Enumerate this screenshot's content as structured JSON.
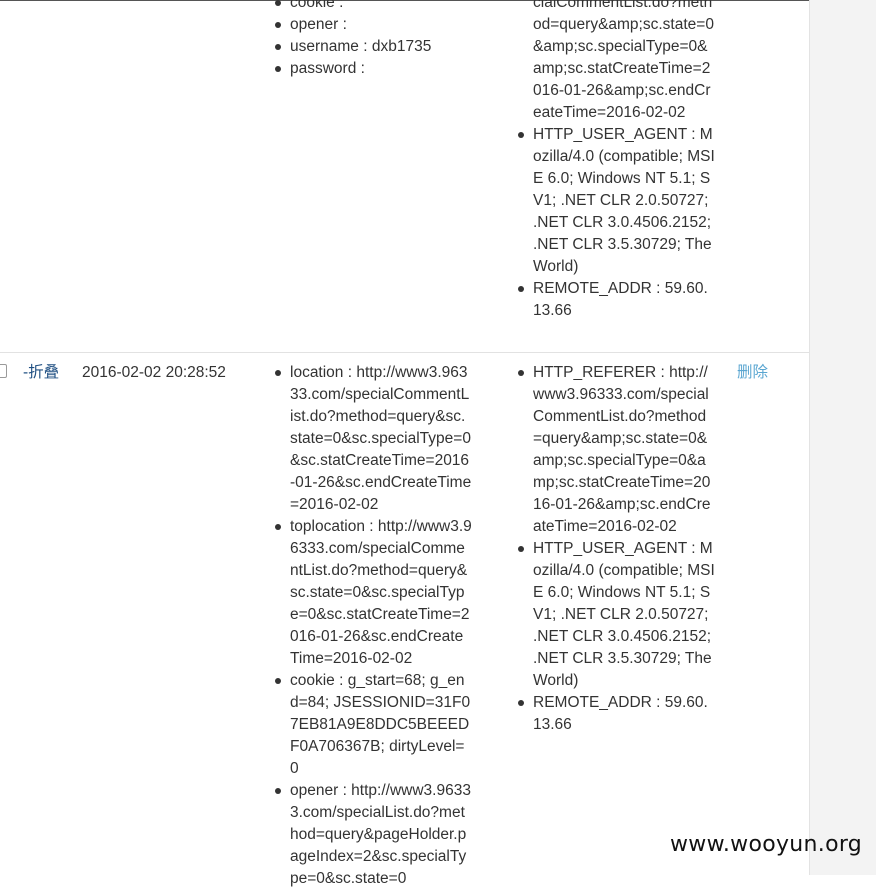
{
  "row1": {
    "get_items": [
      {
        "key": "cookie",
        "value": ""
      },
      {
        "key": "opener",
        "value": ""
      },
      {
        "key": "username",
        "value": "dxb1735"
      },
      {
        "key": "password",
        "value": ""
      }
    ],
    "header_items": [
      {
        "text": "cialCommentList.do?method=query&amp;sc.state=0&amp;sc.specialType=0&amp;sc.statCreateTime=2016-01-26&amp;sc.endCreateTime=2016-02-02"
      },
      {
        "text": "HTTP_USER_AGENT : Mozilla/4.0 (compatible; MSIE 6.0; Windows NT 5.1; SV1; .NET CLR 2.0.50727; .NET CLR 3.0.4506.2152; .NET CLR 3.5.30729; TheWorld)"
      },
      {
        "text": "REMOTE_ADDR : 59.60.13.66"
      }
    ]
  },
  "row2": {
    "toggle_label": "-折叠",
    "timestamp": "2016-02-02 20:28:52",
    "get_items": [
      {
        "text": "location : http://www3.96333.com/specialCommentList.do?method=query&sc.state=0&sc.specialType=0&sc.statCreateTime=2016-01-26&sc.endCreateTime=2016-02-02"
      },
      {
        "text": "toplocation : http://www3.96333.com/specialCommentList.do?method=query&sc.state=0&sc.specialType=0&sc.statCreateTime=2016-01-26&sc.endCreateTime=2016-02-02"
      },
      {
        "text": "cookie : g_start=68; g_end=84; JSESSIONID=31F07EB81A9E8DDC5BEEEDF0A706367B; dirtyLevel=0"
      },
      {
        "text": "opener : http://www3.96333.com/specialList.do?method=query&pageHolder.pageIndex=2&sc.specialType=0&sc.state=0"
      }
    ],
    "header_items": [
      {
        "text": "HTTP_REFERER : http://www3.96333.com/specialCommentList.do?method=query&amp;sc.state=0&amp;sc.specialType=0&amp;sc.statCreateTime=2016-01-26&amp;sc.endCreateTime=2016-02-02"
      },
      {
        "text": "HTTP_USER_AGENT : Mozilla/4.0 (compatible; MSIE 6.0; Windows NT 5.1; SV1; .NET CLR 2.0.50727; .NET CLR 3.0.4506.2152; .NET CLR 3.5.30729; TheWorld)"
      },
      {
        "text": "REMOTE_ADDR : 59.60.13.66"
      }
    ],
    "delete_label": "删除"
  },
  "watermark": "www.wooyun.org"
}
